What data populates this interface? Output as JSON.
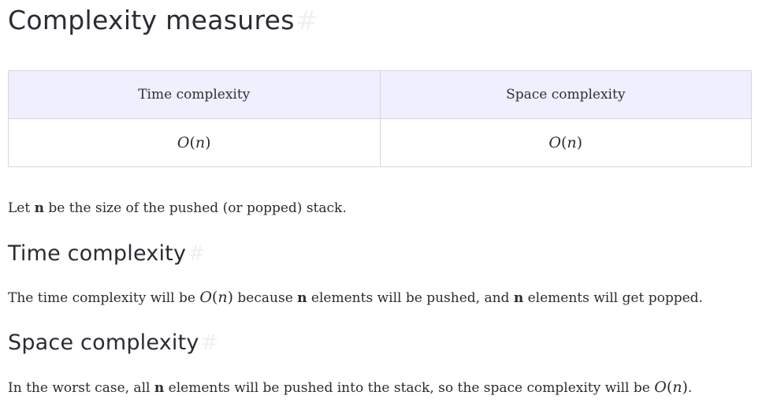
{
  "heading": {
    "title": "Complexity measures",
    "anchor": "#"
  },
  "table": {
    "headers": [
      "Time complexity",
      "Space complexity"
    ],
    "row": [
      "O(n)",
      "O(n)"
    ]
  },
  "intro": {
    "before": "Let ",
    "bold": "n",
    "after": " be the size of the pushed (or popped) stack."
  },
  "time_section": {
    "title": "Time complexity",
    "anchor": "#",
    "text_before": "The time complexity will be ",
    "math": "O(n)",
    "text_middle": " because ",
    "bold1": "n",
    "text_middle2": " elements will be pushed, and ",
    "bold2": "n",
    "text_after": " elements will get popped."
  },
  "space_section": {
    "title": "Space complexity",
    "anchor": "#",
    "text_before": "In the worst case, all ",
    "bold": "n",
    "text_middle": " elements will be pushed into the stack, so the space complexity will be ",
    "math": "O(n)",
    "text_after": "."
  }
}
